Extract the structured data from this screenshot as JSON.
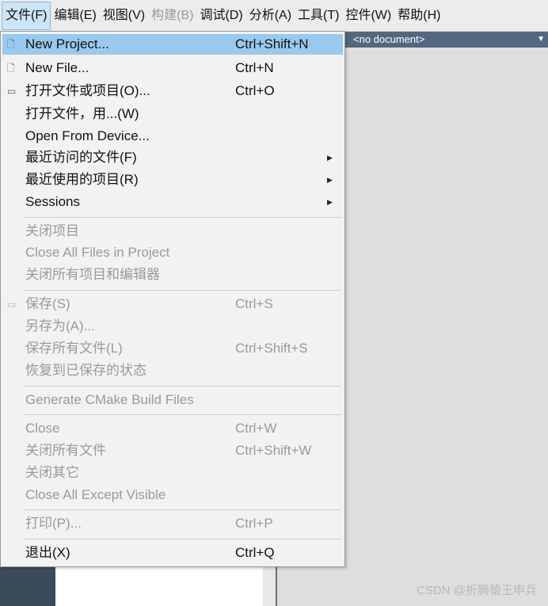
{
  "menubar": {
    "items": [
      {
        "label": "文件(F)",
        "active": true,
        "enabled": true
      },
      {
        "label": "编辑(E)",
        "enabled": true
      },
      {
        "label": "视图(V)",
        "enabled": true
      },
      {
        "label": "构建(B)",
        "enabled": false
      },
      {
        "label": "调试(D)",
        "enabled": true
      },
      {
        "label": "分析(A)",
        "enabled": true
      },
      {
        "label": "工具(T)",
        "enabled": true
      },
      {
        "label": "控件(W)",
        "enabled": true
      },
      {
        "label": "帮助(H)",
        "enabled": true
      }
    ]
  },
  "document_bar": {
    "text": "<no document>",
    "dropdown_icon": "chevron-down-icon"
  },
  "file_menu": {
    "items": [
      {
        "label": "New Project...",
        "shortcut": "Ctrl+Shift+N",
        "icon": "file-icon"
      },
      {
        "label": "New File...",
        "shortcut": "Ctrl+N",
        "icon": "file-icon"
      },
      {
        "label": "打开文件或项目(O)...",
        "shortcut": "Ctrl+O",
        "icon": "folder-icon"
      },
      {
        "label": "打开文件，用...(W)",
        "shortcut": ""
      },
      {
        "label": "Open From Device...",
        "shortcut": ""
      },
      {
        "label": "最近访问的文件(F)",
        "shortcut": "",
        "submenu": true
      },
      {
        "label": "最近使用的项目(R)",
        "shortcut": "",
        "submenu": true
      },
      {
        "label": "Sessions",
        "shortcut": "",
        "submenu": true
      },
      {
        "label": "关闭项目",
        "shortcut": "",
        "disabled": true
      },
      {
        "label": "Close All Files in Project",
        "shortcut": "",
        "disabled": true
      },
      {
        "label": "关闭所有项目和编辑器",
        "shortcut": "",
        "disabled": true
      },
      {
        "label": "保存(S)",
        "shortcut": "Ctrl+S",
        "disabled": true,
        "icon": "save-icon"
      },
      {
        "label": "另存为(A)...",
        "shortcut": "",
        "disabled": true
      },
      {
        "label": "保存所有文件(L)",
        "shortcut": "Ctrl+Shift+S",
        "disabled": true
      },
      {
        "label": "恢复到已保存的状态",
        "shortcut": "",
        "disabled": true
      },
      {
        "label": "Generate CMake Build Files",
        "shortcut": "",
        "disabled": true
      },
      {
        "label": "Close",
        "shortcut": "Ctrl+W",
        "disabled": true
      },
      {
        "label": "关闭所有文件",
        "shortcut": "Ctrl+Shift+W",
        "disabled": true
      },
      {
        "label": "关闭其它",
        "shortcut": "",
        "disabled": true
      },
      {
        "label": "Close All Except Visible",
        "shortcut": "",
        "disabled": true
      },
      {
        "label": "打印(P)...",
        "shortcut": "Ctrl+P",
        "disabled": true
      },
      {
        "label": "退出(X)",
        "shortcut": "Ctrl+Q"
      }
    ]
  },
  "watermark": "CSDN @折腾猿王申兵",
  "colors": {
    "highlight": "#99c9ef",
    "disabled_text": "#9a9a9a",
    "doc_bar": "#53687f"
  }
}
